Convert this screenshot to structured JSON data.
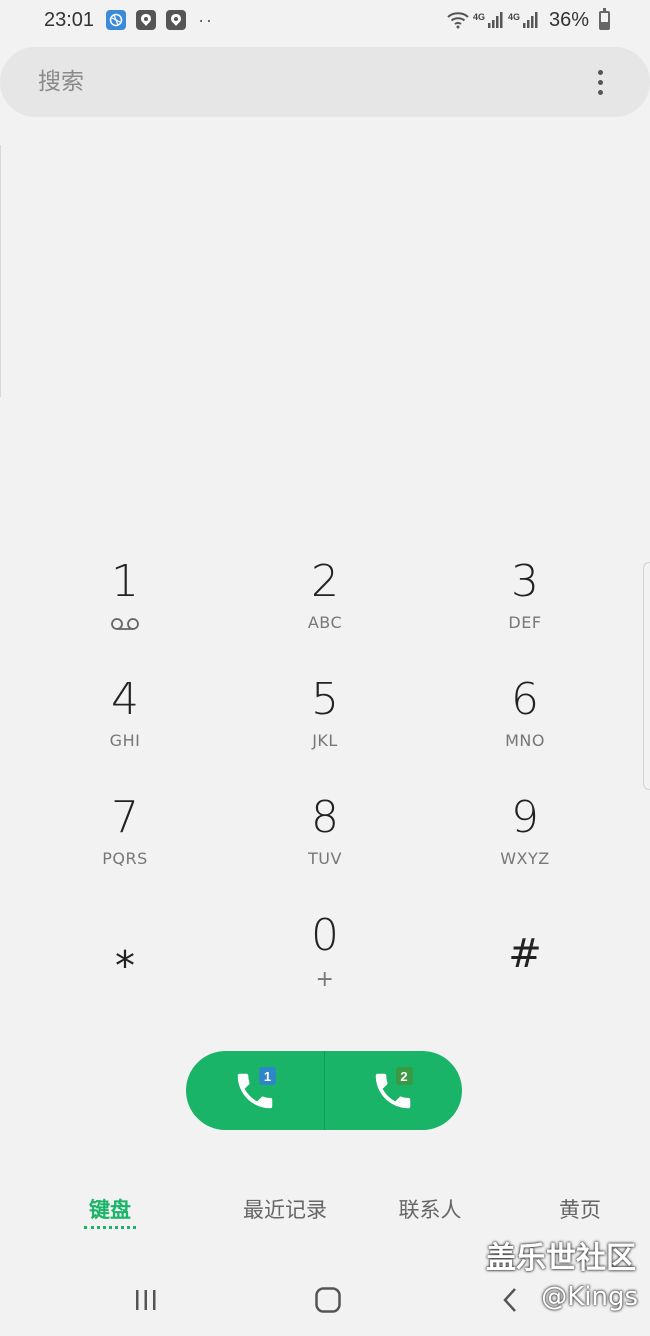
{
  "status_bar": {
    "time": "23:01",
    "dots": "··",
    "net1": "4G",
    "net2": "4G",
    "battery": "36%",
    "battery_level": 0.36
  },
  "search": {
    "placeholder": "搜索"
  },
  "keypad": {
    "rows": [
      [
        {
          "digit": "1",
          "letters": "",
          "icon": "voicemail-icon"
        },
        {
          "digit": "2",
          "letters": "ABC"
        },
        {
          "digit": "3",
          "letters": "DEF"
        }
      ],
      [
        {
          "digit": "4",
          "letters": "GHI"
        },
        {
          "digit": "5",
          "letters": "JKL"
        },
        {
          "digit": "6",
          "letters": "MNO"
        }
      ],
      [
        {
          "digit": "7",
          "letters": "PQRS"
        },
        {
          "digit": "8",
          "letters": "TUV"
        },
        {
          "digit": "9",
          "letters": "WXYZ"
        }
      ],
      [
        {
          "digit": "⁎",
          "letters": ""
        },
        {
          "digit": "0",
          "letters": "+"
        },
        {
          "digit": "#",
          "letters": ""
        }
      ]
    ]
  },
  "call": {
    "sim1": "1",
    "sim2": "2",
    "color": "#19b468"
  },
  "tabs": [
    {
      "label": "键盘",
      "active": true
    },
    {
      "label": "最近记录",
      "active": false
    },
    {
      "label": "联系人",
      "active": false
    },
    {
      "label": "黄页",
      "active": false
    }
  ],
  "watermark": {
    "line1": "盖乐世社区",
    "line2": "@Kings"
  }
}
